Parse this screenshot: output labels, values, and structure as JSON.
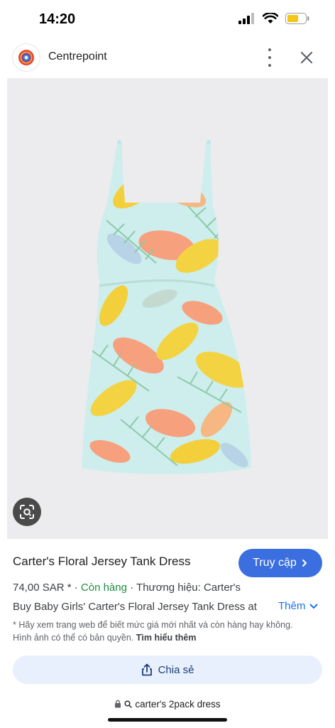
{
  "status": {
    "time": "14:20",
    "icons": [
      "signal-icon",
      "wifi-icon",
      "battery-icon"
    ]
  },
  "header": {
    "site_name": "Centrepoint",
    "logo_icon": "centrepoint-logo",
    "menu_icon": "more-vert-icon",
    "close_icon": "close-icon"
  },
  "image": {
    "alt": "Carter's Floral Jersey Tank Dress",
    "lens_icon": "google-lens-icon"
  },
  "product": {
    "title": "Carter's Floral Jersey Tank Dress",
    "visit_label": "Truy cập",
    "price": "74,00 SAR *",
    "separator": "·",
    "stock": "Còn hàng",
    "brand": "Thương hiệu: Carter's",
    "description": "Buy Baby Girls' Carter's Floral Jersey Tank Dress at",
    "more_label": "Thêm",
    "note_text": "* Hãy xem trang web để biết mức giá mới nhất và còn hàng hay không. Hình ảnh có thể có bản quyền.",
    "learn_more": "Tìm hiểu thêm",
    "share_label": "Chia sẻ"
  },
  "address_bar": {
    "query": "carter's 2pack dress"
  },
  "colors": {
    "accent": "#3b6fe0",
    "stock_green": "#1e8e3e",
    "link_blue": "#1a73e8",
    "share_bg": "#e8f0fe"
  }
}
